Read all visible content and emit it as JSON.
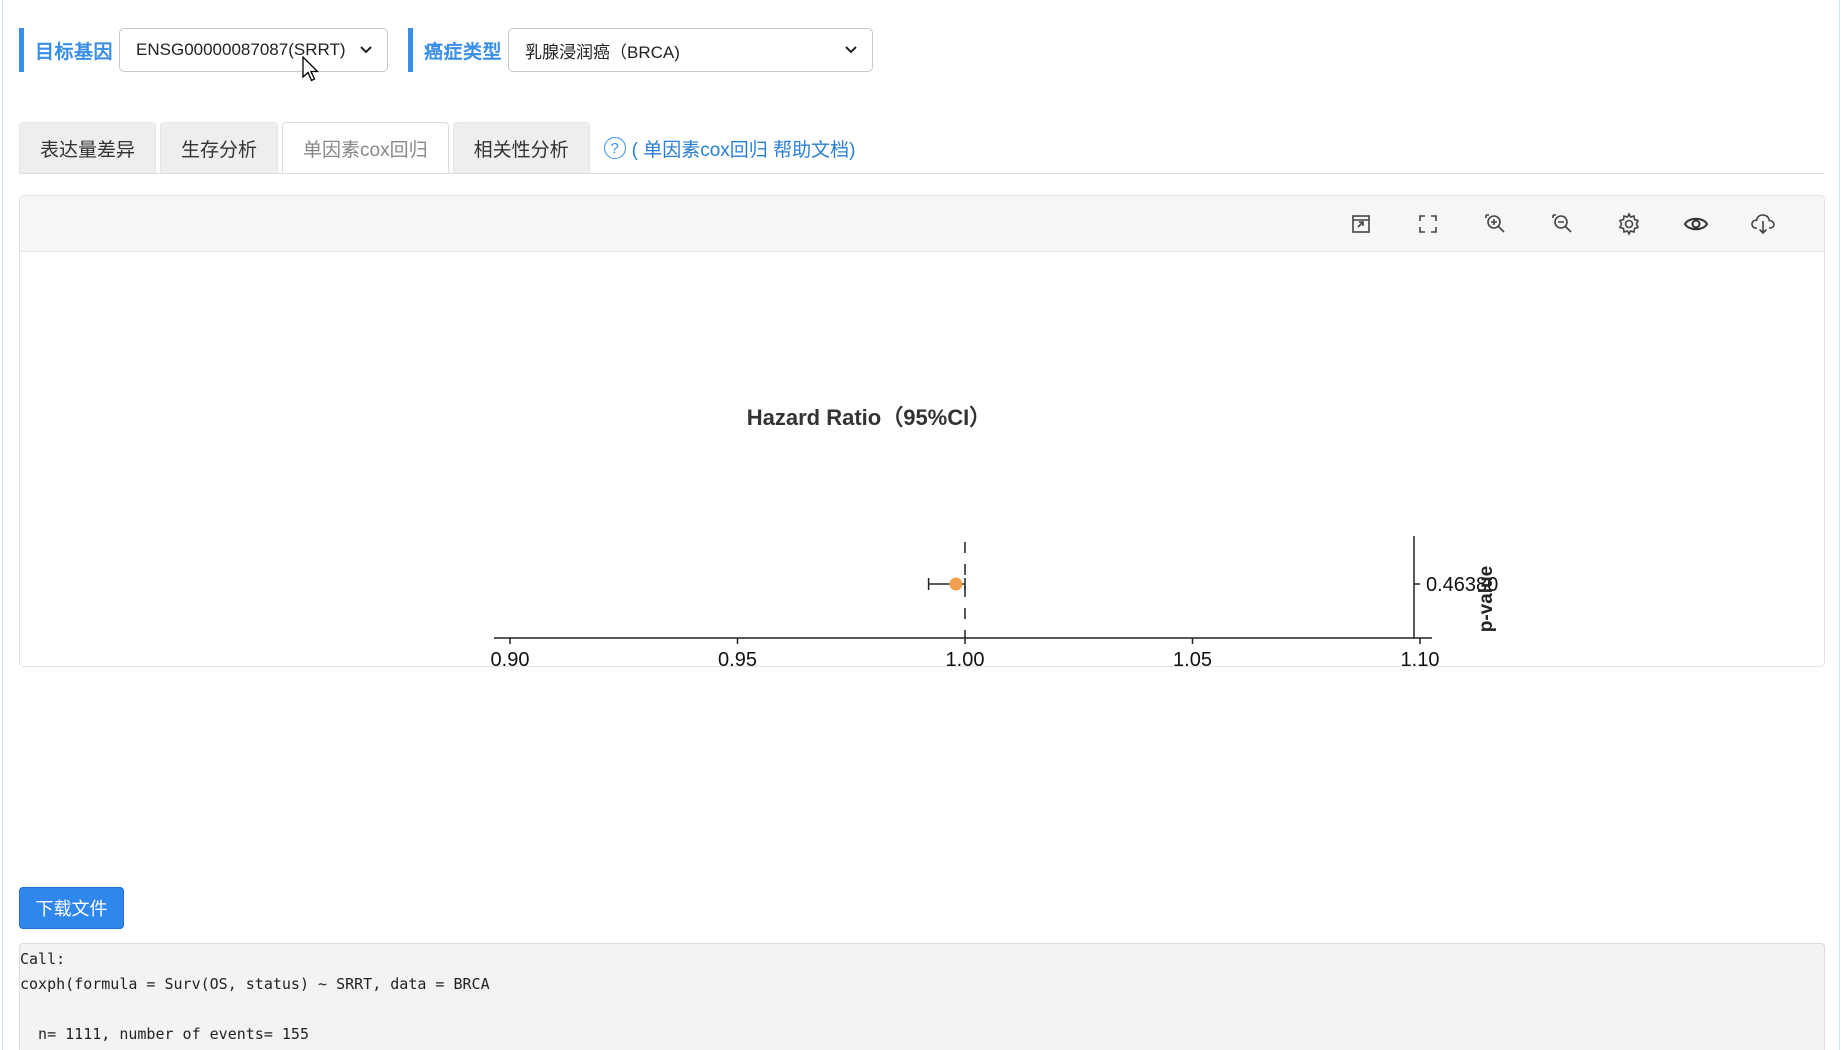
{
  "selectors": {
    "gene": {
      "label": "目标基因",
      "value": "ENSG00000087087(SRRT)"
    },
    "cancer": {
      "label": "癌症类型",
      "value": "乳腺浸润癌（BRCA)"
    }
  },
  "tabs": [
    {
      "label": "表达量差异"
    },
    {
      "label": "生存分析"
    },
    {
      "label": "单因素cox回归"
    },
    {
      "label": "相关性分析"
    }
  ],
  "help": {
    "icon": "?",
    "text": "( 单因素cox回归 帮助文档)"
  },
  "toolbar": [
    "restore-icon",
    "fullscreen-icon",
    "zoom-in-icon",
    "zoom-out-icon",
    "settings-icon",
    "preview-icon",
    "download-cloud-icon"
  ],
  "chart_data": {
    "type": "scatter",
    "title": "Hazard Ratio（95%CI）",
    "x_ticks": [
      "0.90",
      "0.95",
      "1.00",
      "1.05",
      "1.10"
    ],
    "xlim": [
      0.9,
      1.1
    ],
    "reference_line": 1.0,
    "points": [
      {
        "hr": 0.998,
        "ci_low": 0.992,
        "ci_high": 1.0,
        "p_value": "0.46380"
      }
    ],
    "right_axis_label": "p-value",
    "point_color": "#f0a050"
  },
  "download_label": "下载文件",
  "output_lines": [
    "Call:",
    "coxph(formula = Surv(OS, status) ~ SRRT, data = BRCA",
    "",
    "  n= 1111, number of events= 155"
  ]
}
